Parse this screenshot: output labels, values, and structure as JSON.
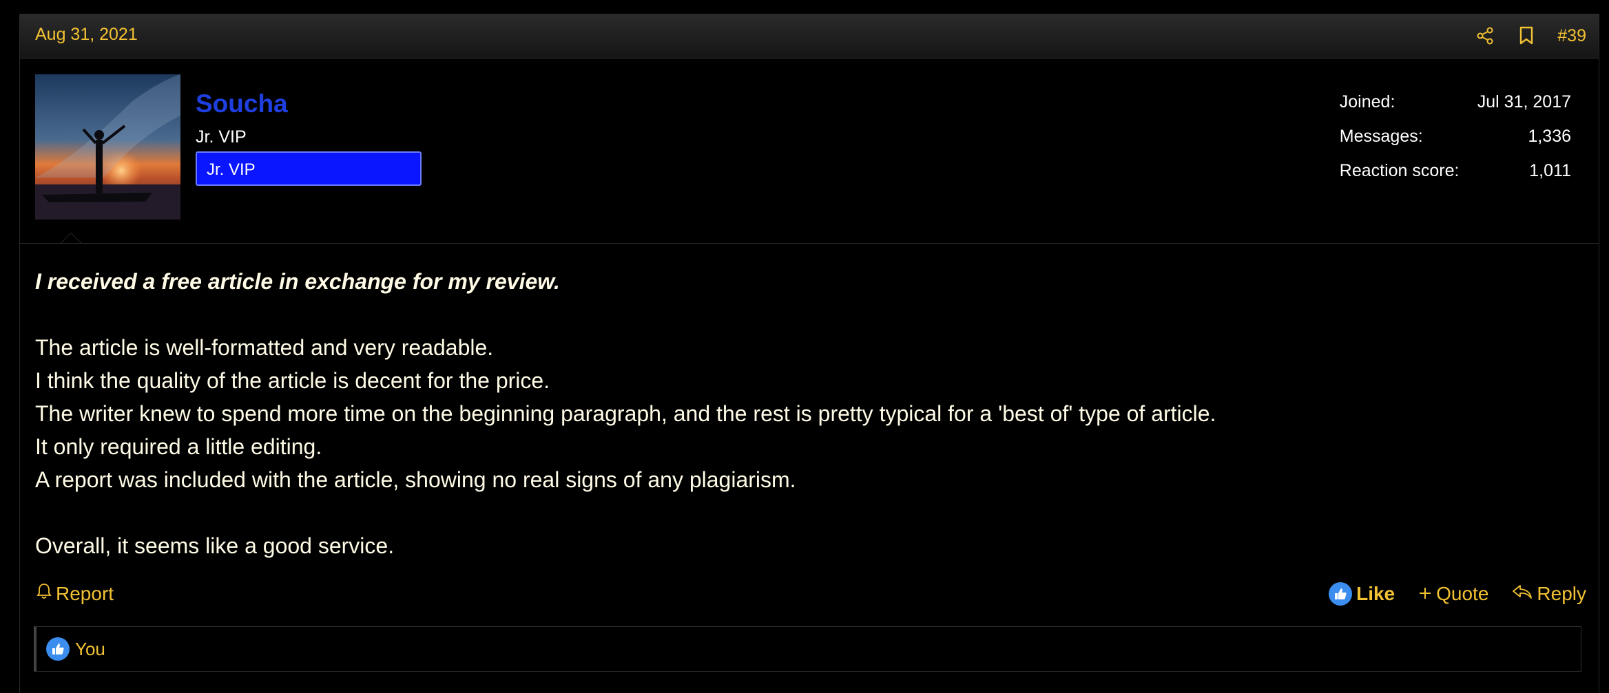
{
  "post": {
    "date": "Aug 31, 2021",
    "number": "#39",
    "icons": [
      "share-icon",
      "bookmark-icon"
    ]
  },
  "user": {
    "name": "Soucha",
    "title": "Jr. VIP",
    "banner": "Jr. VIP",
    "stats": [
      {
        "label": "Joined:",
        "value": "Jul 31, 2017"
      },
      {
        "label": "Messages:",
        "value": "1,336"
      },
      {
        "label": "Reaction score:",
        "value": "1,011"
      }
    ]
  },
  "content": {
    "disclaimer": "I received a free article in exchange for my review.",
    "lines": [
      "The article is well-formatted and very readable.",
      "I think the quality of the article is decent for the price.",
      "The writer knew to spend more time on the beginning paragraph, and the rest is pretty typical for a 'best of' type of article.",
      "It only required a little editing.",
      "A report was included with the article, showing no real signs of any plagiarism."
    ],
    "closing": "Overall, it seems like a good service."
  },
  "actions": {
    "report": "Report",
    "like": "Like",
    "quote": "Quote",
    "reply": "Reply"
  },
  "reactions": {
    "text": "You"
  },
  "colors": {
    "accent": "#f3c233",
    "username": "#1f3fe0",
    "banner_bg": "#0a16ff",
    "like_blue": "#3b8ef0"
  }
}
